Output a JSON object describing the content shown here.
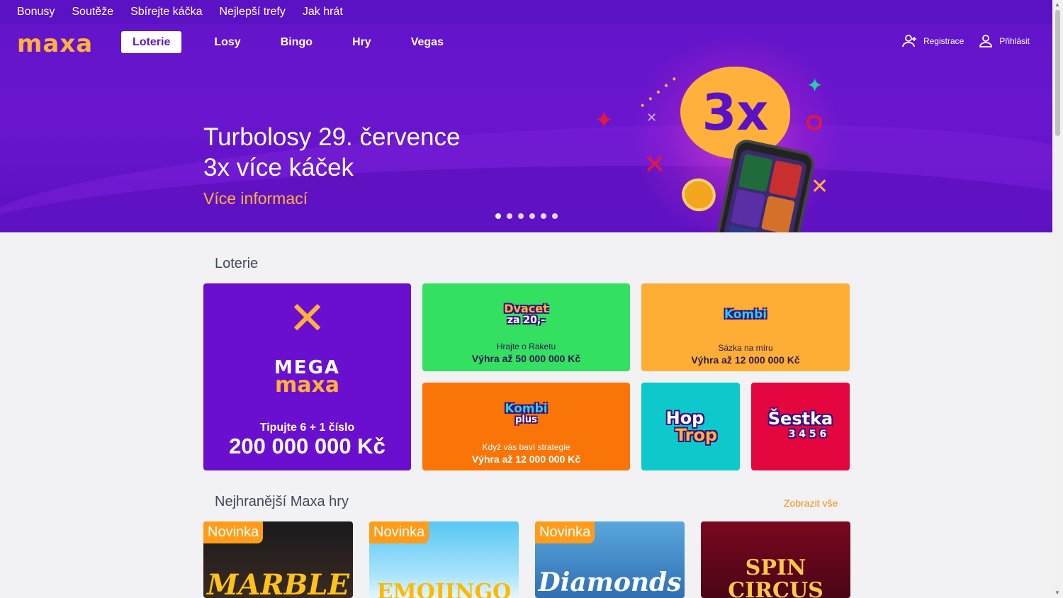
{
  "topbar": {
    "links": [
      "Bonusy",
      "Soutěže",
      "Sbírejte káčka",
      "Nejlepší trefy",
      "Jak hrát"
    ]
  },
  "header": {
    "logo": "maxa",
    "tabs": [
      "Loterie",
      "Losy",
      "Bingo",
      "Hry",
      "Vegas"
    ],
    "active_tab": "Loterie",
    "register": "Registrace",
    "login": "Přihlásit"
  },
  "hero": {
    "title_line1": "Turbolosy 29. července",
    "title_line2": "3x více káček",
    "cta": "Více informací",
    "badge": "3x",
    "slides": 6,
    "active_slide": 0
  },
  "lottery": {
    "title": "Loterie",
    "mega": {
      "logo_top": "MEGA",
      "logo_bottom": "maxa",
      "sub": "Tipujte 6 + 1 číslo",
      "win": "200 000 000 Kč"
    },
    "dvacet": {
      "logo": "Dvacet",
      "logo_small": "za 20,-",
      "sub": "Hrajte o Raketu",
      "win": "Výhra až 50 000 000 Kč"
    },
    "kombi": {
      "logo": "Kombi",
      "sub": "Sázka na míru",
      "win": "Výhra až 12 000 000 Kč"
    },
    "kombiplus": {
      "logo": "Kombi",
      "logo_small": "plus",
      "sub": "Když vás baví strategie",
      "win": "Výhra až 12 000 000 Kč"
    },
    "hoptrop": {
      "logo_top": "Hop",
      "logo_bottom": "Trop"
    },
    "sestka": {
      "logo": "Šestka",
      "logo_small": "3 4 5 6"
    }
  },
  "popular": {
    "title": "Nejhranější Maxa hry",
    "show_all": "Zobrazit vše",
    "games": [
      {
        "badge": "Novinka",
        "title": "MARBLE"
      },
      {
        "badge": "Novinka",
        "title": "EMOJINGO"
      },
      {
        "badge": "Novinka",
        "title": "Diamonds"
      },
      {
        "badge": "",
        "title": "SPIN CIRCUS"
      }
    ]
  },
  "colors": {
    "brand_purple": "#6314c9",
    "accent_orange": "#ffb13b",
    "green": "#33e060",
    "card_orange": "#ffae35",
    "kombi_plus": "#f97507",
    "teal": "#0dc9cc",
    "red": "#e3063f"
  }
}
